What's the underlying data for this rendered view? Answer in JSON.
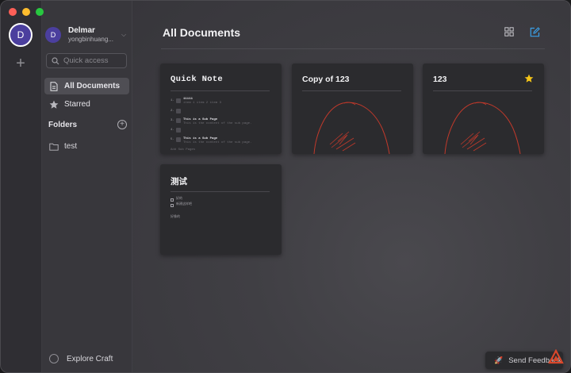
{
  "rail": {
    "avatar_initial": "D",
    "add_symbol": "+"
  },
  "user": {
    "initial": "D",
    "name": "Delmar",
    "subtitle": "yongbinhuang..."
  },
  "search": {
    "placeholder": "Quick access"
  },
  "nav": {
    "all_documents": "All Documents",
    "starred": "Starred"
  },
  "folders": {
    "title": "Folders",
    "add_symbol": "+",
    "items": [
      "test"
    ]
  },
  "explore": {
    "label": "Explore Craft"
  },
  "main": {
    "title": "All Documents"
  },
  "documents": [
    {
      "title": "Quick Note",
      "preview": {
        "l1": "11111",
        "l1b": "item 1   item 2   item 3",
        "l3": "This is a Sub Page",
        "l3b": "This is the content of the sub page.",
        "l5": "This is a Sub Page",
        "l5b": "This is the content of the sub page.",
        "l6": "Add Sub Pages"
      }
    },
    {
      "title": "Copy of 123",
      "starred": false
    },
    {
      "title": "123",
      "starred": true
    },
    {
      "title": "测试",
      "preview": {
        "todo1": "好的",
        "todo2": "新建这样吧",
        "text": "好像的"
      }
    }
  ],
  "feedback": {
    "label": "Send Feedback",
    "icon": "rocket-icon"
  },
  "colors": {
    "accent_blue": "#3aa0e8",
    "star_yellow": "#f5c518",
    "sketch_red": "#c0392b",
    "avatar_purple": "#4b3f9e"
  }
}
